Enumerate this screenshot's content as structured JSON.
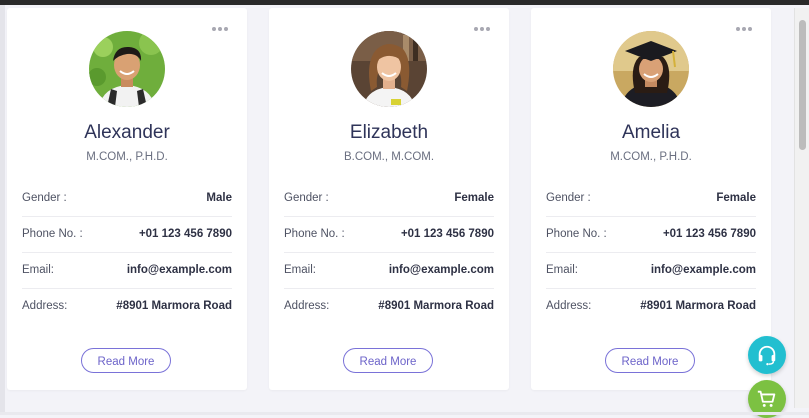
{
  "cards": [
    {
      "name": "Alexander",
      "degree": "M.COM., P.H.D.",
      "avatar_icon": "male-student-photo",
      "fields": [
        {
          "label": "Gender :",
          "value": "Male"
        },
        {
          "label": "Phone No. :",
          "value": "+01 123 456 7890"
        },
        {
          "label": "Email:",
          "value": "info@example.com"
        },
        {
          "label": "Address:",
          "value": "#8901 Marmora Road"
        }
      ],
      "button_label": "Read More"
    },
    {
      "name": "Elizabeth",
      "degree": "B.COM., M.COM.",
      "avatar_icon": "female-student-photo",
      "fields": [
        {
          "label": "Gender :",
          "value": "Female"
        },
        {
          "label": "Phone No. :",
          "value": "+01 123 456 7890"
        },
        {
          "label": "Email:",
          "value": "info@example.com"
        },
        {
          "label": "Address:",
          "value": "#8901 Marmora Road"
        }
      ],
      "button_label": "Read More"
    },
    {
      "name": "Amelia",
      "degree": "M.COM., P.H.D.",
      "avatar_icon": "graduate-photo",
      "fields": [
        {
          "label": "Gender :",
          "value": "Female"
        },
        {
          "label": "Phone No. :",
          "value": "+01 123 456 7890"
        },
        {
          "label": "Email:",
          "value": "info@example.com"
        },
        {
          "label": "Address:",
          "value": "#8901 Marmora Road"
        }
      ],
      "button_label": "Read More"
    }
  ],
  "floating_buttons": [
    {
      "icon": "headset-icon",
      "color": "#22bfd0"
    },
    {
      "icon": "cart-icon",
      "color": "#7cc142"
    }
  ],
  "colors": {
    "title": "#2f3459",
    "accent": "#7a72d8",
    "background": "#f3f3f8"
  }
}
